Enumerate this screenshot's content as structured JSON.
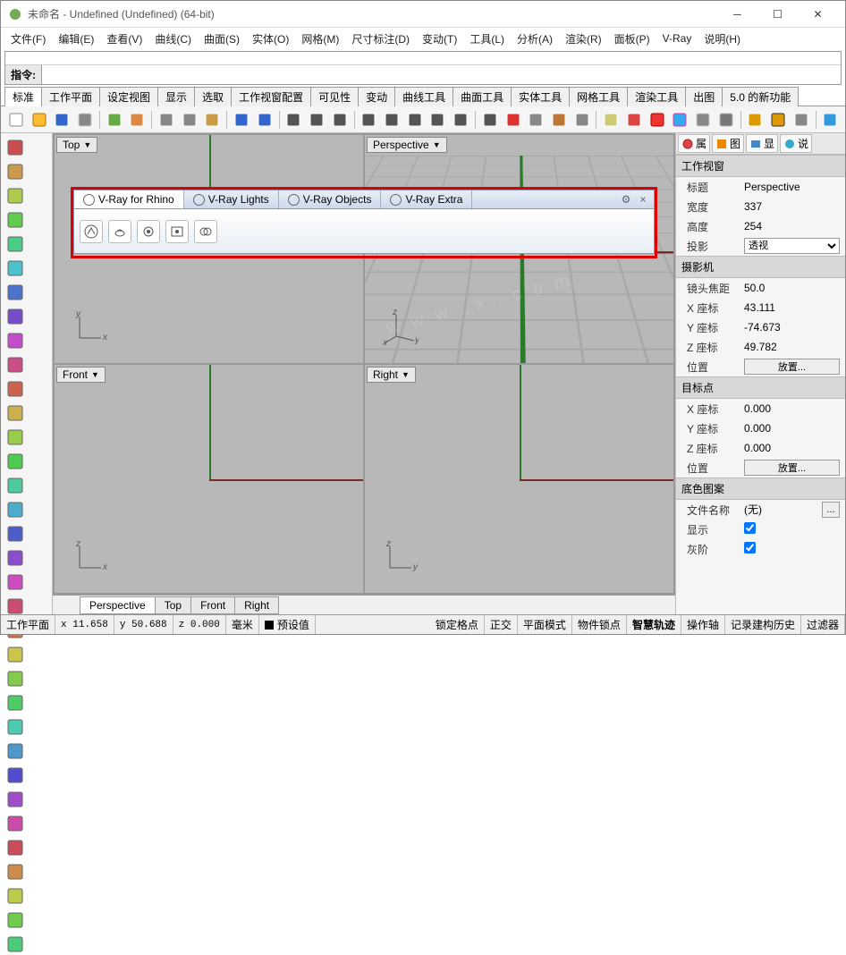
{
  "title": "未命名 - Undefined (Undefined) (64-bit)",
  "menu": [
    "文件(F)",
    "编辑(E)",
    "查看(V)",
    "曲线(C)",
    "曲面(S)",
    "实体(O)",
    "网格(M)",
    "尺寸标注(D)",
    "变动(T)",
    "工具(L)",
    "分析(A)",
    "渲染(R)",
    "面板(P)",
    "V-Ray",
    "说明(H)"
  ],
  "cmd": {
    "label": "指令:"
  },
  "tabs": [
    "标准",
    "工作平面",
    "设定视图",
    "显示",
    "选取",
    "工作视窗配置",
    "可见性",
    "变动",
    "曲线工具",
    "曲面工具",
    "实体工具",
    "网格工具",
    "渲染工具",
    "出图",
    "5.0 的新功能"
  ],
  "tabs_active": 0,
  "viewports": {
    "tl": {
      "label": "Top",
      "ax1": "y",
      "ax2": "x"
    },
    "tr": {
      "label": "Perspective",
      "ax1": "z",
      "ax2": "y",
      "ax3": "x"
    },
    "bl": {
      "label": "Front",
      "ax1": "z",
      "ax2": "x"
    },
    "br": {
      "label": "Right",
      "ax1": "z",
      "ax2": "y"
    }
  },
  "vray": {
    "tabs": [
      "V-Ray for Rhino",
      "V-Ray Lights",
      "V-Ray Objects",
      "V-Ray Extra"
    ],
    "active": 0
  },
  "viewtabs": [
    "Perspective",
    "Top",
    "Front",
    "Right"
  ],
  "viewtabs_active": 0,
  "rp": {
    "tabs": [
      {
        "t": "属"
      },
      {
        "t": "图"
      },
      {
        "t": ""
      },
      {
        "t": "显"
      },
      {
        "t": "说"
      }
    ],
    "sec1": "工作视窗",
    "title_k": "标题",
    "title_v": "Perspective",
    "width_k": "宽度",
    "width_v": "337",
    "height_k": "高度",
    "height_v": "254",
    "proj_k": "投影",
    "proj_v": "透视",
    "sec2": "摄影机",
    "focal_k": "镜头焦距",
    "focal_v": "50.0",
    "x_k": "X 座标",
    "x_v": "43.111",
    "y_k": "Y 座标",
    "y_v": "-74.673",
    "z_k": "Z 座标",
    "z_v": "49.782",
    "pos_k": "位置",
    "pos_btn": "放置...",
    "sec3": "目标点",
    "tx_k": "X 座标",
    "tx_v": "0.000",
    "ty_k": "Y 座标",
    "ty_v": "0.000",
    "tz_k": "Z 座标",
    "tz_v": "0.000",
    "tpos_k": "位置",
    "tpos_btn": "放置...",
    "sec4": "底色图案",
    "fname_k": "文件名称",
    "fname_v": "(无)",
    "show_k": "显示",
    "gray_k": "灰阶"
  },
  "status": {
    "cplane": "工作平面",
    "x": "x 11.658",
    "y": "y 50.688",
    "z": "z 0.000",
    "unit": "毫米",
    "preset": "预设值",
    "items": [
      "锁定格点",
      "正交",
      "平面模式",
      "物件锁点",
      "智慧轨迹",
      "操作轴",
      "记录建构历史",
      "过滤器"
    ],
    "bold_idx": 4
  }
}
